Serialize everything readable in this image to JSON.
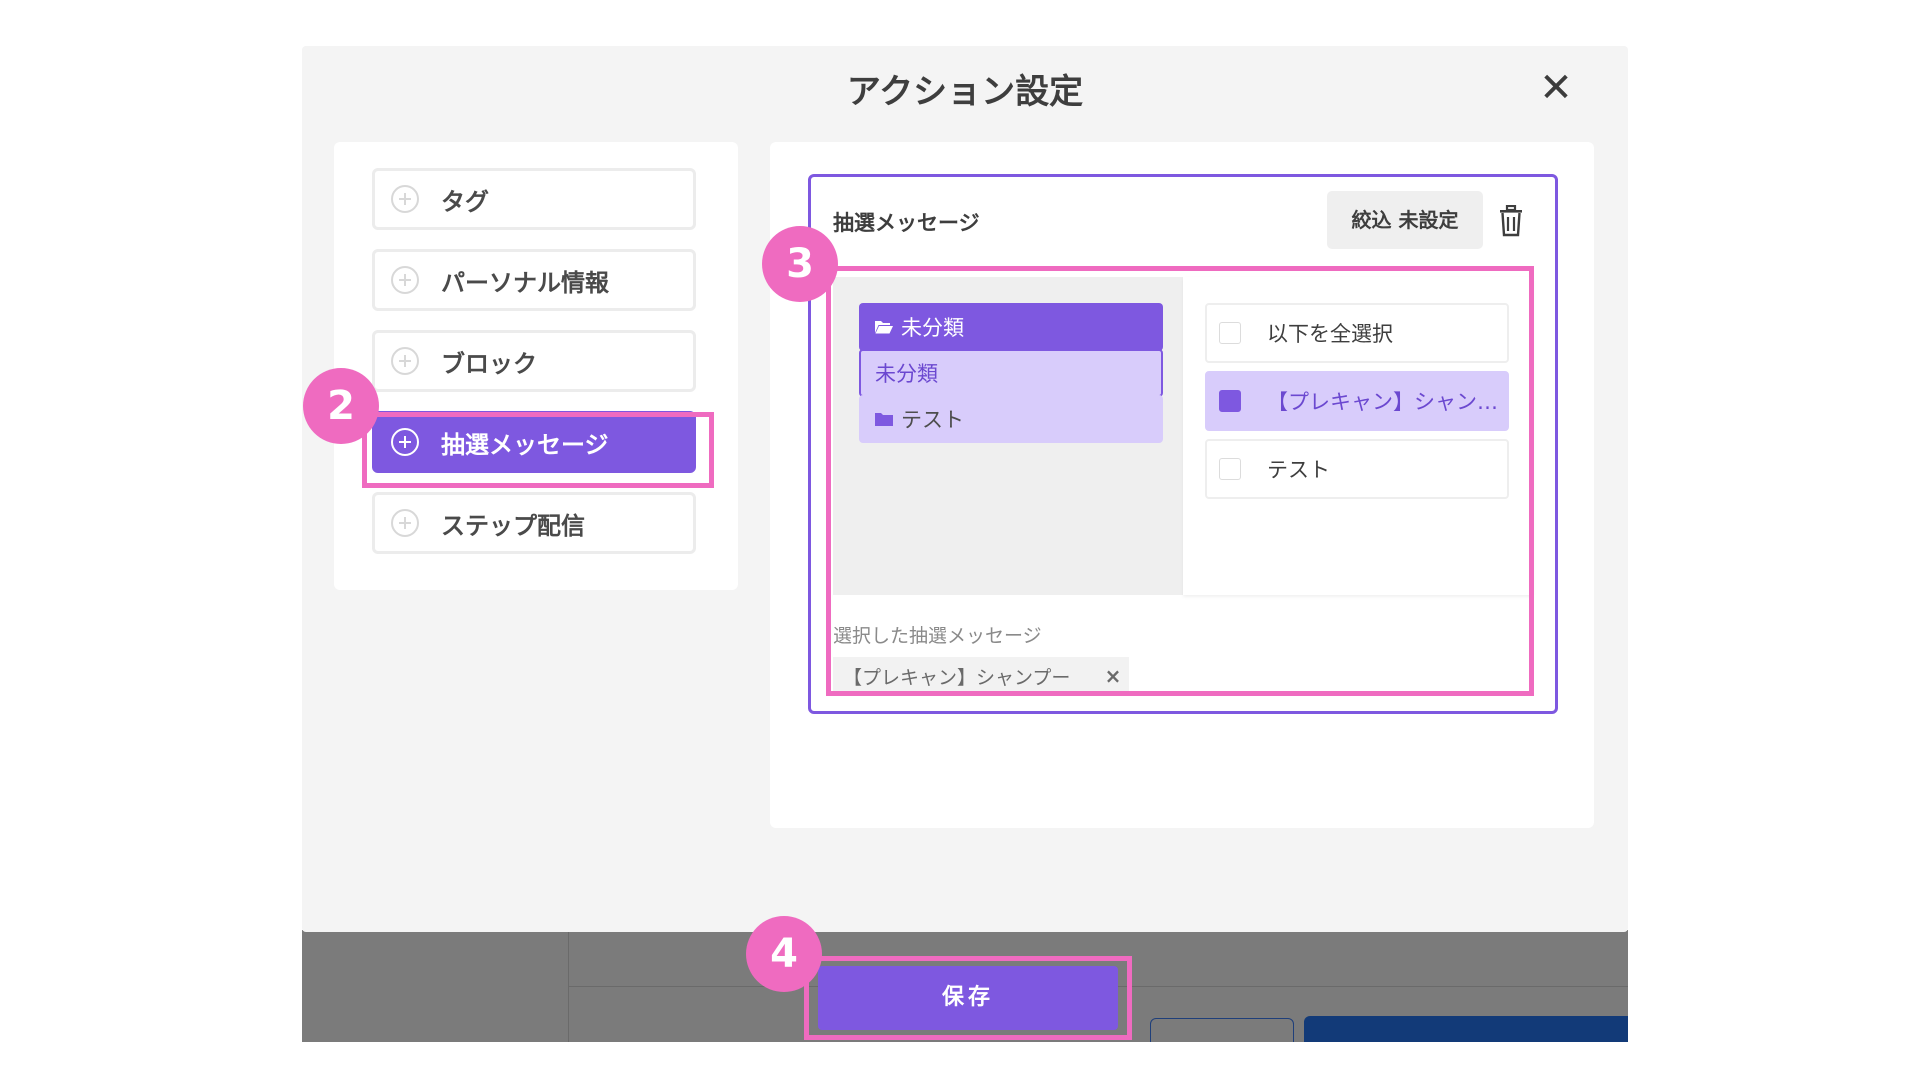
{
  "modal": {
    "title": "アクション設定",
    "close_label": "✕"
  },
  "sidebar": {
    "items": [
      {
        "label": "タグ"
      },
      {
        "label": "パーソナル情報"
      },
      {
        "label": "ブロック"
      },
      {
        "label": "抽選メッセージ",
        "active": true
      },
      {
        "label": "ステップ配信"
      }
    ]
  },
  "card": {
    "title": "抽選メッセージ",
    "filter_button": "絞込 未設定",
    "folders": [
      {
        "label": "未分類",
        "icon": "folder-open-icon",
        "state": "active"
      },
      {
        "label": "未分類",
        "state": "selected"
      },
      {
        "label": "テスト",
        "icon": "folder-icon"
      }
    ],
    "list": [
      {
        "label": "以下を全選択",
        "checked": false
      },
      {
        "label": "【プレキャン】シャン…",
        "checked": true
      },
      {
        "label": "テスト",
        "checked": false
      }
    ],
    "selected_label": "選択した抽選メッセージ",
    "selected_chip": "【プレキャン】シャンプー",
    "chip_remove": "×"
  },
  "footer": {
    "save_label": "保存"
  },
  "annotations": {
    "badge_2": "2",
    "badge_3": "3",
    "badge_4": "4"
  },
  "colors": {
    "accent": "#7e58e0",
    "accent_light": "#d8ccfb",
    "highlight": "#ef6bc0",
    "dark_blue": "#123a78"
  }
}
